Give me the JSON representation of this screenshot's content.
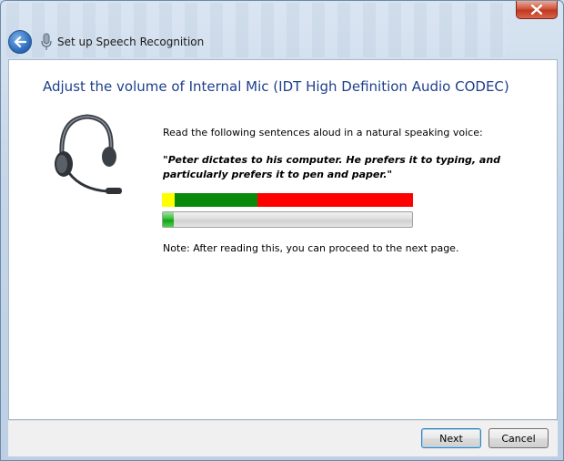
{
  "window": {
    "title": "Set up Speech Recognition"
  },
  "main": {
    "heading": "Adjust the volume of Internal Mic (IDT High Definition Audio CODEC)",
    "instruction": "Read the following sentences aloud in a natural speaking voice:",
    "quote": "\"Peter dictates to his computer. He prefers it to typing, and particularly prefers it to pen and paper.\"",
    "note": "Note: After reading this, you can proceed to the next page.",
    "level_meter": {
      "segments": [
        {
          "name": "low",
          "fraction": 0.05,
          "color": "#ffff00"
        },
        {
          "name": "good",
          "fraction": 0.33,
          "color": "#0a8a0a"
        },
        {
          "name": "loud",
          "fraction": 0.62,
          "color": "#ff0000"
        }
      ]
    },
    "volume_progress": 0.045,
    "icon": "headset-microphone-icon"
  },
  "footer": {
    "next_label": "Next",
    "cancel_label": "Cancel"
  }
}
